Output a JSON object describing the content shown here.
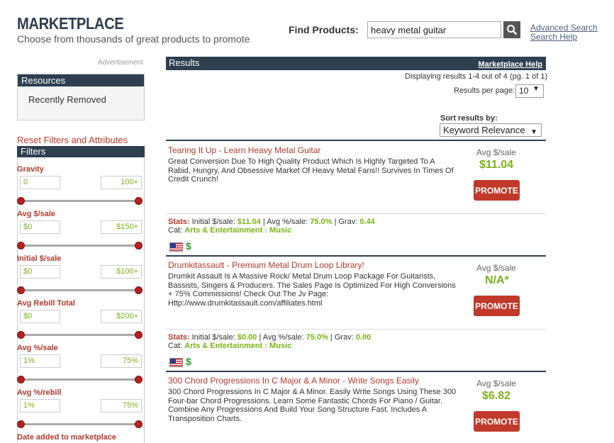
{
  "header": {
    "title": "MARKETPLACE",
    "subtitle": "Choose from thousands of great products to promote",
    "find_label": "Find Products:",
    "search_value": "heavy metal guitar",
    "advanced_search": "Advanced Search",
    "search_help": "Search Help"
  },
  "sidebar": {
    "ad_label": "Advertisement",
    "resources_title": "Resources",
    "recently_removed": "Recently Removed",
    "reset_link": "Reset Filters and Attributes",
    "filters_title": "Filters",
    "filters": [
      {
        "label": "Gravity",
        "min": "0",
        "max": "100+"
      },
      {
        "label": "Avg $/sale",
        "min": "$0",
        "max": "$150+"
      },
      {
        "label": "Initial $/sale",
        "min": "$0",
        "max": "$100+"
      },
      {
        "label": "Avg Rebill Total",
        "min": "$0",
        "max": "$200+"
      },
      {
        "label": "Avg %/sale",
        "min": "1%",
        "max": "75%"
      },
      {
        "label": "Avg %/rebill",
        "min": "1%",
        "max": "75%"
      }
    ],
    "date_added": "Date added to marketplace"
  },
  "results": {
    "title": "Results",
    "help_link": "Marketplace Help",
    "displaying": "Displaying results 1-4 out of 4 (pg. 1 of 1)",
    "per_page_label": "Results per page:",
    "per_page_value": "10",
    "sort_label": "Sort results by:",
    "sort_value": "Keyword Relevance",
    "avg_label": "Avg $/sale",
    "promote_label": "PROMOTE",
    "stats_label": "Stats:",
    "cat_label": "Cat:",
    "items": [
      {
        "title": "Tearing It Up - Learn Heavy Metal Guitar",
        "description": "Great Conversion Due To High Quality Product Which Is Highly Targeted To A Rabid, Hungry, And Obsessive Market Of Heavy Metal Fans!! Survives In Times Of Credit Crunch!",
        "avg_sale": "$11.04",
        "initial_sale": "$11.04",
        "avg_pct_sale": "75.0%",
        "gravity": "0.44",
        "category": "Arts & Entertainment : Music"
      },
      {
        "title": "Drumkitassault - Premium Metal Drum Loop Library!",
        "description": "Drumkit Assault Is A Massive Rock/ Metal Drum Loop Package For Guitarists, Bassists, Singers & Producers. The Sales Page Is Optimized For High Conversions + 75% Commissions! Check Out The Jv Page: Http://www.drumkitassault.com/affiliates.html",
        "avg_sale": "N/A*",
        "initial_sale": "$0.00",
        "avg_pct_sale": "75.0%",
        "gravity": "0.00",
        "category": "Arts & Entertainment : Music"
      },
      {
        "title": "300 Chord Progressions In C Major & A Minor - Write Songs Easily",
        "description": "300 Chord Progressions In C Major & A Minor. Easily Write Songs Using These 300 Four-bar Chord Progressions. Learn Some Fantastic Chords For Piano / Guitar. Combine Any Progressions And Build Your Song Structure Fast. Includes A Transposition Charts.",
        "avg_sale": "$6.82"
      }
    ]
  },
  "icons": {
    "search": "magnifier-icon",
    "flag": "us-flag-icon",
    "dollar": "dollar-icon"
  },
  "colors": {
    "navy": "#2e3f4f",
    "accent_red": "#c0392b",
    "green": "#7ab317"
  }
}
